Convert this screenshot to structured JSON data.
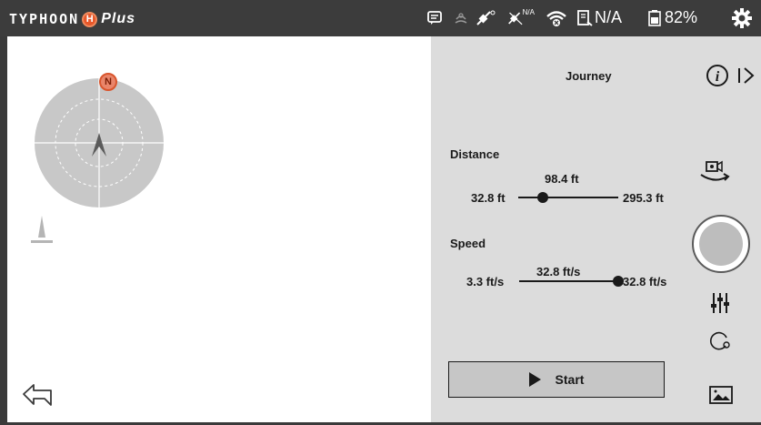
{
  "header": {
    "brand_name": "TYPHOON",
    "brand_badge": "H",
    "brand_suffix": "Plus",
    "gps_status": "N/A",
    "signal_text": "N/A",
    "battery_text": "82%",
    "icons": [
      "message-icon",
      "wave-icon",
      "satellite-icon",
      "satellite-off-icon",
      "wifi-off-icon",
      "remote-signal-icon",
      "battery-icon",
      "settings-icon"
    ]
  },
  "map": {
    "north_label": "N",
    "icons": [
      "radar-compass",
      "aircraft-arrow-icon",
      "home-marker-icon",
      "back-arrow-icon"
    ]
  },
  "panel": {
    "title": "Journey",
    "distance": {
      "label": "Distance",
      "min_text": "32.8 ft",
      "max_text": "295.3 ft",
      "current_text": "98.4 ft",
      "min": 32.8,
      "max": 295.3,
      "value": 98.4
    },
    "speed": {
      "label": "Speed",
      "min_text": "3.3 ft/s",
      "max_text": "32.8 ft/s",
      "current_text": "32.8 ft/s",
      "min": 3.3,
      "max": 32.8,
      "value": 32.8
    },
    "start_label": "Start"
  },
  "sidebar": {
    "icons": [
      "info-icon",
      "collapse-arrow-icon",
      "camera-switch-icon",
      "shutter-button",
      "sliders-icon",
      "mode-circle-icon",
      "gallery-icon"
    ]
  },
  "colors": {
    "topbar": "#3c3c3c",
    "panel": "#dcdcdc",
    "accent": "#e7572a",
    "radar": "#c8c8c8"
  }
}
